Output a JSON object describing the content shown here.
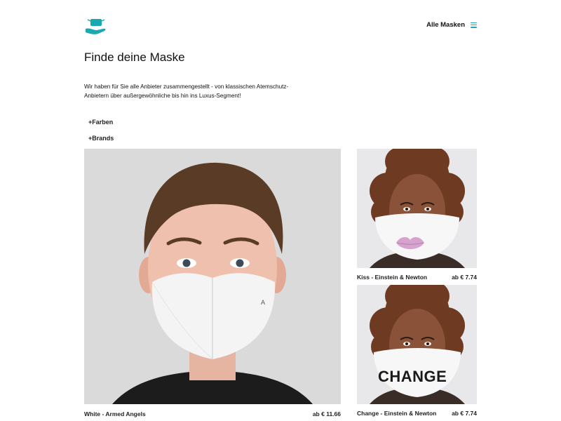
{
  "header": {
    "logo_icon": "hand-with-mask-logo-icon",
    "nav_label": "Alle Masken",
    "menu_icon": "hamburger-menu-icon",
    "accent_color": "#19a9b0"
  },
  "main": {
    "title": "Finde deine Maske",
    "intro": "Wir haben für Sie alle Anbieter zusammengestellt - von klassischen Atemschutz-Anbietern über außergewöhnliche bis hin ins Luxus-Segment!",
    "filters": [
      "+Farben",
      "+Brands"
    ]
  },
  "products": [
    {
      "name": "White - Armed Angels",
      "price": "ab € 11.66"
    },
    {
      "name": "Kiss - Einstein & Newton",
      "price": "ab € 7.74"
    },
    {
      "name": "Change - Einstein & Newton",
      "price": "ab € 7.74"
    }
  ],
  "mask_print": {
    "text": "CHANGE"
  }
}
